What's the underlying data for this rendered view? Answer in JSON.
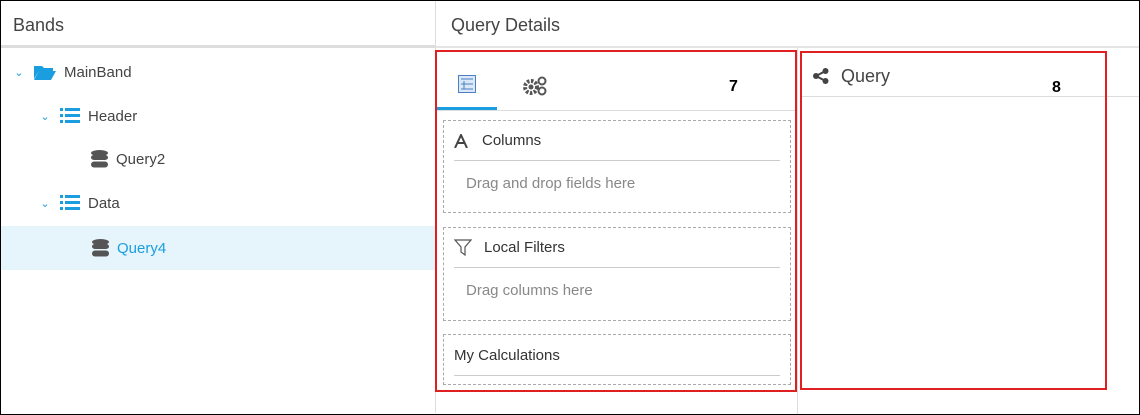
{
  "bands": {
    "title": "Bands",
    "items": [
      {
        "label": "MainBand",
        "icon": "folder-open-icon"
      },
      {
        "label": "Header",
        "icon": "list-icon"
      },
      {
        "label": "Query2",
        "icon": "database-icon"
      },
      {
        "label": "Data",
        "icon": "list-icon"
      },
      {
        "label": "Query4",
        "icon": "database-icon",
        "selected": true
      }
    ]
  },
  "details": {
    "title": "Query Details",
    "tabs": [
      {
        "icon": "fields-icon",
        "active": true
      },
      {
        "icon": "gears-icon"
      }
    ],
    "zones": [
      {
        "title": "Columns",
        "hint": "Drag and drop fields here"
      },
      {
        "title": "Local Filters",
        "hint": "Drag columns here"
      },
      {
        "title": "My Calculations"
      }
    ]
  },
  "query": {
    "title": "Query",
    "icon": "share-icon"
  },
  "annotations": {
    "a7": "7",
    "a8": "8"
  },
  "colors": {
    "accent": "#1a9ee0",
    "annotation": "#e02020"
  }
}
